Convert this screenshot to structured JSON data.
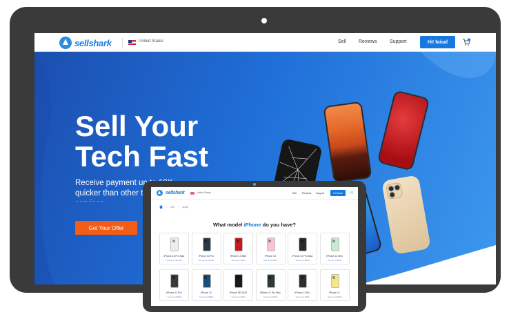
{
  "desktop": {
    "nav": {
      "logo_text": "sellshark",
      "country": "United States",
      "links": [
        "Sell",
        "Reviews",
        "Support"
      ],
      "user_button": "Hi! faisal"
    },
    "hero": {
      "title": "Sell Your Tech Fast",
      "subtitle": "Receive payment up to 10X quicker than other trade-in services",
      "cta": "Get Your Offer"
    }
  },
  "tablet": {
    "nav": {
      "logo_text": "sellshark",
      "country": "United States",
      "links": [
        "Sell",
        "Reviews",
        "Support"
      ],
      "user_button": "Hi! faisal"
    },
    "breadcrumb": [
      "Sell",
      "Apple"
    ],
    "heading_prefix": "What model ",
    "heading_brand": "iPhone",
    "heading_suffix": " do you have?",
    "models": [
      {
        "name": "iPhone 13 Pro Max",
        "price": "Get up to $1,100",
        "color": "#e9eef3"
      },
      {
        "name": "iPhone 13 Pro",
        "price": "Get up to $1,000",
        "color": "#2b3a4a"
      },
      {
        "name": "iPhone 13 Mini",
        "price": "Get up to $500",
        "color": "#c8181e"
      },
      {
        "name": "iPhone 13",
        "price": "Get up to $700",
        "color": "#f6c6cf"
      },
      {
        "name": "iPhone 12 Pro Max",
        "price": "Get up to $800",
        "color": "#2a2a2c"
      },
      {
        "name": "iPhone 12 Mini",
        "price": "Get up to $400",
        "color": "#c9ead2"
      },
      {
        "name": "iPhone 12 Pro",
        "price": "Get up to $600",
        "color": "#3a3a3c"
      },
      {
        "name": "iPhone 12",
        "price": "Get up to $500",
        "color": "#1d4e7a"
      },
      {
        "name": "iPhone SE 2020",
        "price": "Get up to $200",
        "color": "#1a1a1a"
      },
      {
        "name": "iPhone 11 Pro Max",
        "price": "Get up to $700",
        "color": "#2c3a32"
      },
      {
        "name": "iPhone 11 Pro",
        "price": "Get up to $600",
        "color": "#2f2f30"
      },
      {
        "name": "iPhone 11",
        "price": "Get up to $400",
        "color": "#f2e68a"
      }
    ]
  }
}
